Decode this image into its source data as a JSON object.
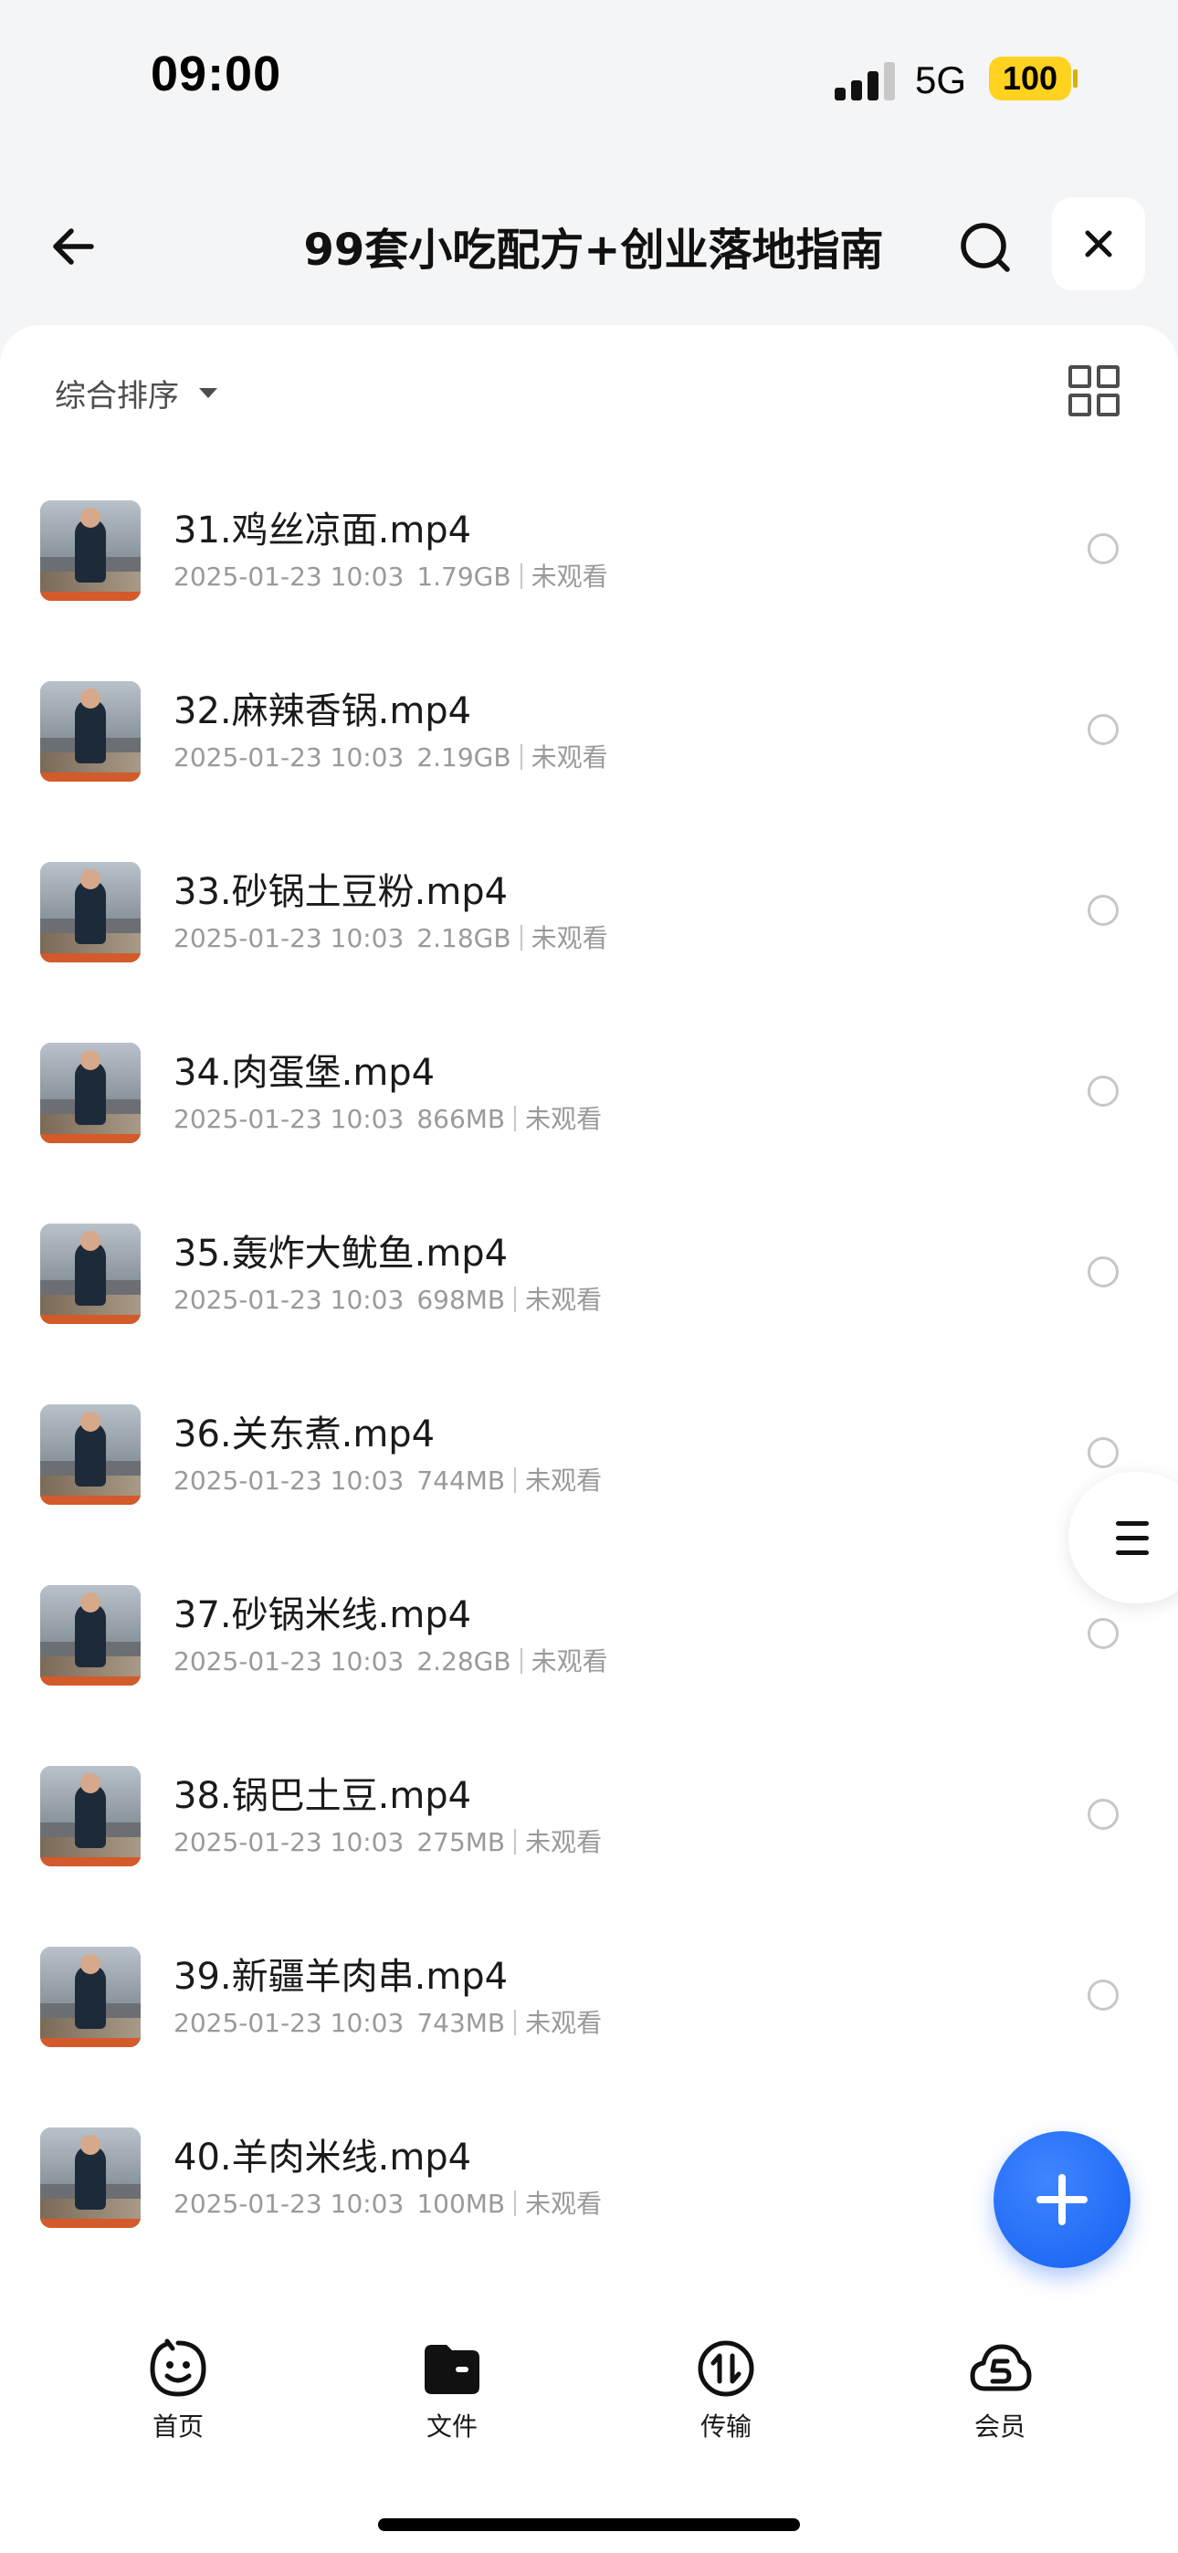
{
  "status_bar": {
    "time": "09:00",
    "network": "5G",
    "battery": "100"
  },
  "header": {
    "title": "99套小吃配方+创业落地指南"
  },
  "toolbar": {
    "sort_label": "综合排序"
  },
  "files": [
    {
      "name": "31.鸡丝凉面.mp4",
      "date": "2025-01-23 10:03",
      "size": "1.79GB",
      "status": "未观看"
    },
    {
      "name": "32.麻辣香锅.mp4",
      "date": "2025-01-23 10:03",
      "size": "2.19GB",
      "status": "未观看"
    },
    {
      "name": "33.砂锅土豆粉.mp4",
      "date": "2025-01-23 10:03",
      "size": "2.18GB",
      "status": "未观看"
    },
    {
      "name": "34.肉蛋堡.mp4",
      "date": "2025-01-23 10:03",
      "size": "866MB",
      "status": "未观看"
    },
    {
      "name": "35.轰炸大鱿鱼.mp4",
      "date": "2025-01-23 10:03",
      "size": "698MB",
      "status": "未观看"
    },
    {
      "name": "36.关东煮.mp4",
      "date": "2025-01-23 10:03",
      "size": "744MB",
      "status": "未观看"
    },
    {
      "name": "37.砂锅米线.mp4",
      "date": "2025-01-23 10:03",
      "size": "2.28GB",
      "status": "未观看"
    },
    {
      "name": "38.锅巴土豆.mp4",
      "date": "2025-01-23 10:03",
      "size": "275MB",
      "status": "未观看"
    },
    {
      "name": "39.新疆羊肉串.mp4",
      "date": "2025-01-23 10:03",
      "size": "743MB",
      "status": "未观看"
    },
    {
      "name": "40.羊肉米线.mp4",
      "date": "2025-01-23 10:03",
      "size": "100MB",
      "status": "未观看"
    }
  ],
  "nav": [
    {
      "label": "首页",
      "icon": "smiley-icon"
    },
    {
      "label": "文件",
      "icon": "folder-icon"
    },
    {
      "label": "传输",
      "icon": "transfer-icon"
    },
    {
      "label": "会员",
      "icon": "cloud-s-icon"
    }
  ],
  "colors": {
    "accent": "#1660f2",
    "battery": "#ffd21f",
    "background": "#f4f5f7"
  }
}
